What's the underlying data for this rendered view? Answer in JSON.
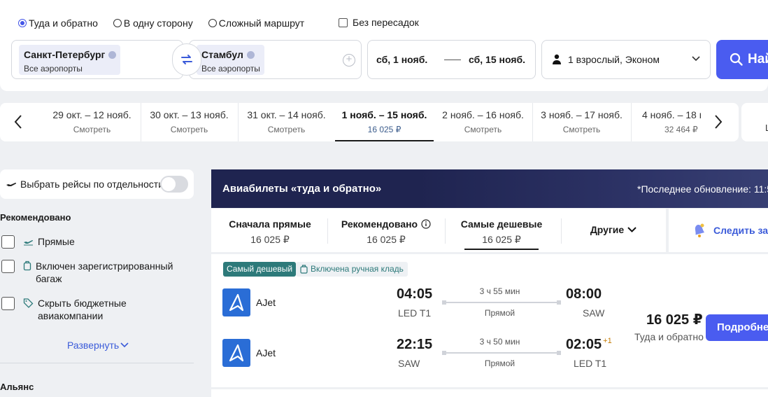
{
  "search": {
    "trip_types": [
      {
        "label": "Туда и обратно",
        "selected": true
      },
      {
        "label": "В одну сторону",
        "selected": false
      },
      {
        "label": "Сложный маршрут",
        "selected": false
      }
    ],
    "direct_only_label": "Без пересадок",
    "from": {
      "city": "Санкт-Петербург",
      "sub": "Все аэропорты"
    },
    "to": {
      "city": "Стамбул",
      "sub": "Все аэропорты"
    },
    "date_from": "сб, 1 нояб.",
    "date_to": "сб, 15 нояб.",
    "passengers": "1 взрослый, Эконом",
    "search_button": "Най"
  },
  "date_strip": [
    {
      "range": "29 окт. – 12 нояб.",
      "sub": "Смотреть",
      "active": false
    },
    {
      "range": "30 окт. – 13 нояб.",
      "sub": "Смотреть",
      "active": false
    },
    {
      "range": "31 окт. – 14 нояб.",
      "sub": "Смотреть",
      "active": false
    },
    {
      "range": "1 нояб. – 15 нояб.",
      "sub": "16 025 ₽",
      "active": true
    },
    {
      "range": "2 нояб. – 16 нояб.",
      "sub": "Смотреть",
      "active": false
    },
    {
      "range": "3 нояб. – 17 нояб.",
      "sub": "Смотреть",
      "active": false
    },
    {
      "range": "4 нояб. – 18 н",
      "sub": "32 464 ₽",
      "active": false
    }
  ],
  "date_strip_right": "L",
  "sidebar": {
    "separate_flights_label": "Выбрать рейсы по отдельности",
    "recommended_heading": "Рекомендовано",
    "filters": [
      {
        "label": "Прямые",
        "icon": "plane-icon"
      },
      {
        "label": "Включен зарегистрированный багаж",
        "icon": "suitcase-icon"
      },
      {
        "label": "Скрыть бюджетные авиакомпании",
        "icon": "tag-icon"
      }
    ],
    "expand_label": "Развернуть",
    "alliance_heading": "Альянс"
  },
  "results": {
    "banner_title": "Авиабилеты «туда и обратно»",
    "banner_update": "*Последнее обновление: 11:5",
    "sort_options": [
      {
        "label": "Сначала прямые",
        "price": "16 025 ₽",
        "active": false,
        "info": false
      },
      {
        "label": "Рекомендовано",
        "price": "16 025 ₽",
        "active": false,
        "info": true
      },
      {
        "label": "Самые дешевые",
        "price": "16 025 ₽",
        "active": true,
        "info": false
      }
    ],
    "other_label": "Другие",
    "track_label": "Следить за ц",
    "ticket": {
      "badge_cheapest": "Самый дешевый",
      "badge_bag": "Включена ручная кладь",
      "legs": [
        {
          "airline": "AJet",
          "dep_time": "04:05",
          "dep_airport": "LED T1",
          "duration": "3 ч 55 мин",
          "kind": "Прямой",
          "arr_time": "08:00",
          "arr_airport": "SAW",
          "plus_day": ""
        },
        {
          "airline": "AJet",
          "dep_time": "22:15",
          "dep_airport": "SAW",
          "duration": "3 ч 50 мин",
          "kind": "Прямой",
          "arr_time": "02:05",
          "arr_airport": "LED T1",
          "plus_day": "+1"
        }
      ],
      "price": "16 025 ₽",
      "price_note": "Туда и обратно",
      "details_button": "Подробне"
    }
  },
  "colors": {
    "accent": "#4a5cf0",
    "banner_bg": "#1f2450",
    "badge_green": "#2d7a7a",
    "airline_blue": "#2a6dd6"
  }
}
